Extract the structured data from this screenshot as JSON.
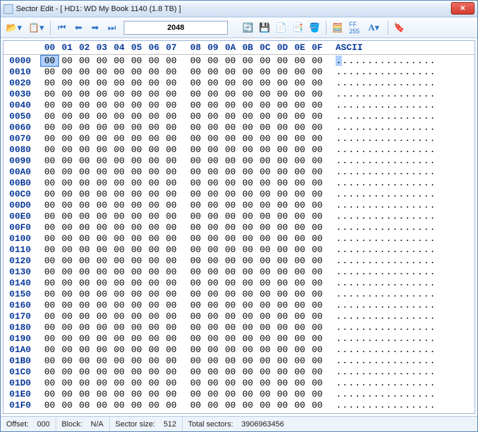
{
  "window": {
    "title": "Sector Edit - [ HD1: WD My Book 1140 (1.8 TB) ]"
  },
  "toolbar": {
    "sector_value": "2048"
  },
  "hex": {
    "header_cols": [
      "00",
      "01",
      "02",
      "03",
      "04",
      "05",
      "06",
      "07",
      "08",
      "09",
      "0A",
      "0B",
      "0C",
      "0D",
      "0E",
      "0F"
    ],
    "ascii_label": "ASCII",
    "offsets": [
      "0000",
      "0010",
      "0020",
      "0030",
      "0040",
      "0050",
      "0060",
      "0070",
      "0080",
      "0090",
      "00A0",
      "00B0",
      "00C0",
      "00D0",
      "00E0",
      "00F0",
      "0100",
      "0110",
      "0120",
      "0130",
      "0140",
      "0150",
      "0160",
      "0170",
      "0180",
      "0190",
      "01A0",
      "01B0",
      "01C0",
      "01D0",
      "01E0",
      "01F0"
    ],
    "byte_value": "00",
    "ascii_char": ".",
    "selected": {
      "row": 0,
      "col": 0
    }
  },
  "status": {
    "offset_label": "Offset:",
    "offset_value": "000",
    "block_label": "Block:",
    "block_value": "N/A",
    "sector_size_label": "Sector size:",
    "sector_size_value": "512",
    "total_sectors_label": "Total sectors:",
    "total_sectors_value": "3906963456"
  }
}
